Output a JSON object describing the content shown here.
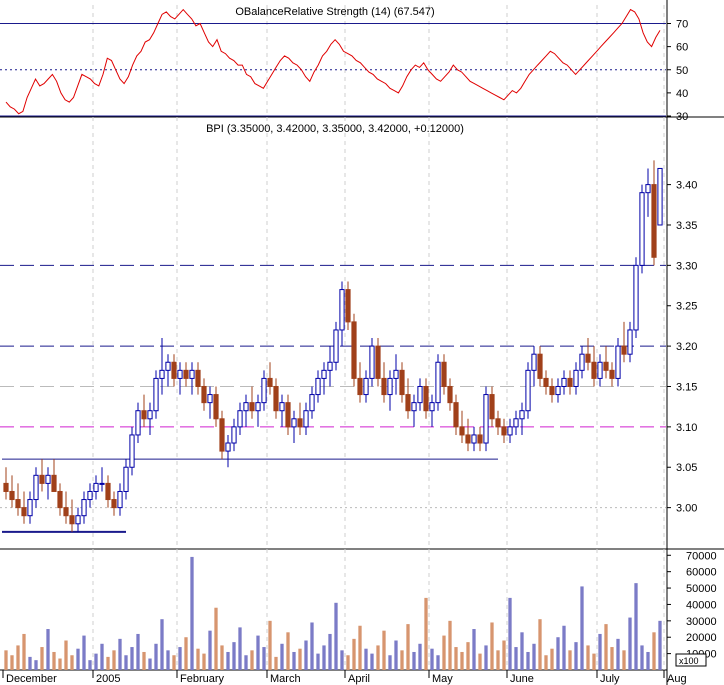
{
  "colors": {
    "up_candle": "#0000a8",
    "down_candle": "#a0401a",
    "rsi_line": "#e00000",
    "vol_up": "#7b7bc7",
    "vol_down": "#d7956f",
    "support_line": "#1a1a8c",
    "magenta_line": "#d020d0",
    "grid": "#cfcfcf"
  },
  "chart_data": [
    {
      "type": "line",
      "panel": "rsi",
      "title": "OBalanceRelative Strength (14) (67.547)",
      "ylim": [
        30,
        78
      ],
      "yticks": [
        "30",
        "40",
        "50",
        "60",
        "70"
      ],
      "reference_lines": [
        70,
        50,
        30
      ],
      "values": [
        36,
        34,
        33,
        31,
        32,
        38,
        42,
        46,
        43,
        44,
        46,
        48,
        45,
        40,
        37,
        36,
        38,
        43,
        48,
        47,
        46,
        44,
        43,
        48,
        55,
        54,
        50,
        46,
        44,
        47,
        52,
        56,
        58,
        62,
        63,
        66,
        70,
        74,
        75,
        73,
        72,
        74,
        76,
        74,
        72,
        69,
        70,
        66,
        62,
        60,
        63,
        58,
        57,
        55,
        54,
        52,
        52,
        48,
        47,
        44,
        43,
        42,
        45,
        48,
        51,
        54,
        56,
        55,
        53,
        52,
        50,
        47,
        45,
        49,
        52,
        56,
        58,
        61,
        63,
        61,
        58,
        57,
        56,
        54,
        53,
        51,
        49,
        48,
        46,
        45,
        44,
        42,
        41,
        40,
        43,
        47,
        50,
        52,
        51,
        53,
        50,
        48,
        46,
        45,
        47,
        49,
        52,
        50,
        49,
        47,
        45,
        44,
        43,
        42,
        41,
        40,
        39,
        38,
        37,
        39,
        41,
        40,
        42,
        45,
        48,
        50,
        52,
        54,
        56,
        58,
        57,
        55,
        53,
        52,
        50,
        48,
        50,
        52,
        54,
        56,
        58,
        60,
        62,
        64,
        66,
        68,
        70,
        73,
        76,
        75,
        72,
        66,
        62,
        60,
        64,
        67
      ],
      "x_axis": "shared"
    },
    {
      "type": "candlestick",
      "panel": "price",
      "title": "BPI (3.35000, 3.42000, 3.35000, 3.42000, +0.12000)",
      "ylim": [
        2.95,
        3.48
      ],
      "yticks": [
        "3.00",
        "3.05",
        "3.10",
        "3.15",
        "3.20",
        "3.25",
        "3.30",
        "3.35",
        "3.40"
      ],
      "x_labels": [
        "December",
        "2005",
        "February",
        "March",
        "April",
        "May",
        "June",
        "July",
        "Aug"
      ],
      "x_label_positions": [
        0,
        15,
        29,
        44,
        57,
        71,
        84,
        99,
        112
      ],
      "horizontal_lines": [
        {
          "value": 3.3,
          "style": "dashed",
          "color": "#1a1a8c"
        },
        {
          "value": 3.2,
          "style": "dashed",
          "color": "#1a1a8c"
        },
        {
          "value": 3.15,
          "style": "dashed",
          "color": "#bbbbbb"
        },
        {
          "value": 3.1,
          "style": "dashed",
          "color": "#d020d0"
        },
        {
          "value": 3.0,
          "style": "dotted",
          "color": "#bbbbbb"
        }
      ],
      "segments": [
        {
          "from_bar": 0,
          "to_bar": 82,
          "value": 3.06,
          "color": "#1a1a8c"
        },
        {
          "from_bar": 0,
          "to_bar": 20,
          "value": 2.97,
          "color": "#1a1a8c"
        }
      ],
      "ohlc": [
        [
          3.03,
          3.05,
          3.01,
          3.02
        ],
        [
          3.02,
          3.04,
          3.0,
          3.01
        ],
        [
          3.01,
          3.03,
          2.99,
          3.0
        ],
        [
          3.0,
          3.02,
          2.98,
          2.99
        ],
        [
          2.99,
          3.02,
          2.98,
          3.01
        ],
        [
          3.01,
          3.05,
          3.0,
          3.04
        ],
        [
          3.04,
          3.06,
          3.02,
          3.03
        ],
        [
          3.03,
          3.05,
          3.01,
          3.04
        ],
        [
          3.04,
          3.06,
          3.02,
          3.02
        ],
        [
          3.02,
          3.03,
          2.99,
          3.0
        ],
        [
          3.0,
          3.02,
          2.98,
          2.99
        ],
        [
          2.99,
          3.01,
          2.97,
          2.98
        ],
        [
          2.98,
          3.0,
          2.97,
          2.99
        ],
        [
          2.99,
          3.02,
          2.98,
          3.01
        ],
        [
          3.01,
          3.03,
          3.0,
          3.02
        ],
        [
          3.02,
          3.04,
          3.01,
          3.03
        ],
        [
          3.03,
          3.05,
          3.02,
          3.03
        ],
        [
          3.03,
          3.04,
          3.0,
          3.01
        ],
        [
          3.01,
          3.02,
          2.99,
          3.0
        ],
        [
          3.0,
          3.03,
          2.99,
          3.02
        ],
        [
          3.02,
          3.06,
          3.01,
          3.05
        ],
        [
          3.05,
          3.1,
          3.04,
          3.09
        ],
        [
          3.09,
          3.13,
          3.08,
          3.12
        ],
        [
          3.12,
          3.14,
          3.1,
          3.11
        ],
        [
          3.11,
          3.13,
          3.09,
          3.12
        ],
        [
          3.12,
          3.17,
          3.11,
          3.16
        ],
        [
          3.16,
          3.21,
          3.14,
          3.17
        ],
        [
          3.17,
          3.19,
          3.15,
          3.18
        ],
        [
          3.18,
          3.19,
          3.15,
          3.16
        ],
        [
          3.16,
          3.18,
          3.14,
          3.17
        ],
        [
          3.17,
          3.18,
          3.15,
          3.16
        ],
        [
          3.16,
          3.18,
          3.14,
          3.17
        ],
        [
          3.17,
          3.18,
          3.14,
          3.15
        ],
        [
          3.15,
          3.16,
          3.12,
          3.13
        ],
        [
          3.13,
          3.15,
          3.11,
          3.14
        ],
        [
          3.14,
          3.15,
          3.1,
          3.11
        ],
        [
          3.11,
          3.12,
          3.06,
          3.07
        ],
        [
          3.07,
          3.09,
          3.05,
          3.08
        ],
        [
          3.08,
          3.11,
          3.07,
          3.1
        ],
        [
          3.1,
          3.13,
          3.09,
          3.12
        ],
        [
          3.12,
          3.14,
          3.1,
          3.13
        ],
        [
          3.13,
          3.15,
          3.11,
          3.12
        ],
        [
          3.12,
          3.14,
          3.1,
          3.13
        ],
        [
          3.13,
          3.17,
          3.12,
          3.16
        ],
        [
          3.16,
          3.18,
          3.14,
          3.15
        ],
        [
          3.15,
          3.16,
          3.11,
          3.12
        ],
        [
          3.12,
          3.14,
          3.1,
          3.13
        ],
        [
          3.13,
          3.14,
          3.09,
          3.1
        ],
        [
          3.1,
          3.12,
          3.08,
          3.11
        ],
        [
          3.11,
          3.13,
          3.09,
          3.1
        ],
        [
          3.1,
          3.13,
          3.09,
          3.12
        ],
        [
          3.12,
          3.15,
          3.11,
          3.14
        ],
        [
          3.14,
          3.17,
          3.13,
          3.16
        ],
        [
          3.16,
          3.18,
          3.14,
          3.17
        ],
        [
          3.17,
          3.2,
          3.15,
          3.18
        ],
        [
          3.18,
          3.23,
          3.17,
          3.22
        ],
        [
          3.22,
          3.28,
          3.2,
          3.27
        ],
        [
          3.27,
          3.28,
          3.22,
          3.23
        ],
        [
          3.23,
          3.24,
          3.15,
          3.16
        ],
        [
          3.16,
          3.18,
          3.13,
          3.14
        ],
        [
          3.14,
          3.17,
          3.13,
          3.16
        ],
        [
          3.16,
          3.21,
          3.15,
          3.2
        ],
        [
          3.2,
          3.21,
          3.15,
          3.16
        ],
        [
          3.16,
          3.18,
          3.13,
          3.14
        ],
        [
          3.14,
          3.17,
          3.12,
          3.16
        ],
        [
          3.16,
          3.19,
          3.14,
          3.17
        ],
        [
          3.17,
          3.18,
          3.13,
          3.14
        ],
        [
          3.14,
          3.16,
          3.11,
          3.12
        ],
        [
          3.12,
          3.14,
          3.1,
          3.13
        ],
        [
          3.13,
          3.16,
          3.12,
          3.15
        ],
        [
          3.15,
          3.16,
          3.11,
          3.12
        ],
        [
          3.12,
          3.14,
          3.1,
          3.13
        ],
        [
          3.13,
          3.19,
          3.12,
          3.18
        ],
        [
          3.18,
          3.19,
          3.14,
          3.15
        ],
        [
          3.15,
          3.16,
          3.12,
          3.13
        ],
        [
          3.13,
          3.14,
          3.09,
          3.1
        ],
        [
          3.1,
          3.12,
          3.08,
          3.09
        ],
        [
          3.09,
          3.11,
          3.07,
          3.08
        ],
        [
          3.08,
          3.1,
          3.07,
          3.09
        ],
        [
          3.09,
          3.1,
          3.07,
          3.08
        ],
        [
          3.08,
          3.15,
          3.07,
          3.14
        ],
        [
          3.14,
          3.15,
          3.1,
          3.11
        ],
        [
          3.11,
          3.12,
          3.09,
          3.1
        ],
        [
          3.1,
          3.11,
          3.08,
          3.09
        ],
        [
          3.09,
          3.11,
          3.08,
          3.1
        ],
        [
          3.1,
          3.12,
          3.09,
          3.11
        ],
        [
          3.11,
          3.13,
          3.09,
          3.12
        ],
        [
          3.12,
          3.18,
          3.11,
          3.17
        ],
        [
          3.17,
          3.2,
          3.15,
          3.19
        ],
        [
          3.19,
          3.2,
          3.15,
          3.16
        ],
        [
          3.16,
          3.17,
          3.14,
          3.15
        ],
        [
          3.15,
          3.16,
          3.13,
          3.14
        ],
        [
          3.14,
          3.16,
          3.13,
          3.15
        ],
        [
          3.15,
          3.17,
          3.14,
          3.16
        ],
        [
          3.16,
          3.17,
          3.14,
          3.15
        ],
        [
          3.15,
          3.18,
          3.14,
          3.17
        ],
        [
          3.17,
          3.2,
          3.16,
          3.19
        ],
        [
          3.19,
          3.21,
          3.17,
          3.18
        ],
        [
          3.18,
          3.2,
          3.15,
          3.16
        ],
        [
          3.16,
          3.19,
          3.15,
          3.18
        ],
        [
          3.18,
          3.2,
          3.16,
          3.17
        ],
        [
          3.17,
          3.18,
          3.15,
          3.16
        ],
        [
          3.16,
          3.21,
          3.15,
          3.2
        ],
        [
          3.2,
          3.23,
          3.18,
          3.19
        ],
        [
          3.19,
          3.23,
          3.18,
          3.22
        ],
        [
          3.22,
          3.31,
          3.21,
          3.3
        ],
        [
          3.3,
          3.4,
          3.29,
          3.39
        ],
        [
          3.39,
          3.42,
          3.36,
          3.4
        ],
        [
          3.4,
          3.43,
          3.3,
          3.31
        ],
        [
          3.35,
          3.42,
          3.35,
          3.42
        ]
      ]
    },
    {
      "type": "bar",
      "panel": "volume",
      "ylim": [
        0,
        72000
      ],
      "yticks": [
        "10000",
        "20000",
        "30000",
        "40000",
        "50000",
        "60000",
        "70000"
      ],
      "unit_label": "x100",
      "values": [
        12000,
        9000,
        15000,
        22000,
        8000,
        6000,
        14000,
        25000,
        11000,
        7000,
        18000,
        9000,
        13000,
        21000,
        6000,
        10000,
        16000,
        8000,
        12000,
        19000,
        9000,
        14000,
        22000,
        11000,
        7000,
        16000,
        31000,
        12000,
        9000,
        14000,
        20000,
        69000,
        13000,
        10000,
        24000,
        38000,
        15000,
        11000,
        17000,
        26000,
        9000,
        12000,
        21000,
        14000,
        30000,
        8000,
        16000,
        23000,
        11000,
        13000,
        18000,
        29000,
        10000,
        15000,
        22000,
        41000,
        12000,
        9000,
        19000,
        27000,
        13000,
        10000,
        15000,
        24000,
        9000,
        18000,
        12000,
        28000,
        11000,
        16000,
        44000,
        13000,
        9000,
        21000,
        30000,
        14000,
        11000,
        17000,
        25000,
        10000,
        15000,
        29000,
        12000,
        18000,
        44000,
        14000,
        23000,
        11000,
        16000,
        31000,
        9000,
        13000,
        20000,
        27000,
        12000,
        17000,
        51000,
        15000,
        10000,
        22000,
        28000,
        14000,
        19000,
        12000,
        32000,
        53000,
        15000,
        11000,
        23000,
        30000,
        17000,
        24000,
        14000,
        43000,
        21000
      ],
      "candle_direction": "derived from price close vs open"
    }
  ]
}
